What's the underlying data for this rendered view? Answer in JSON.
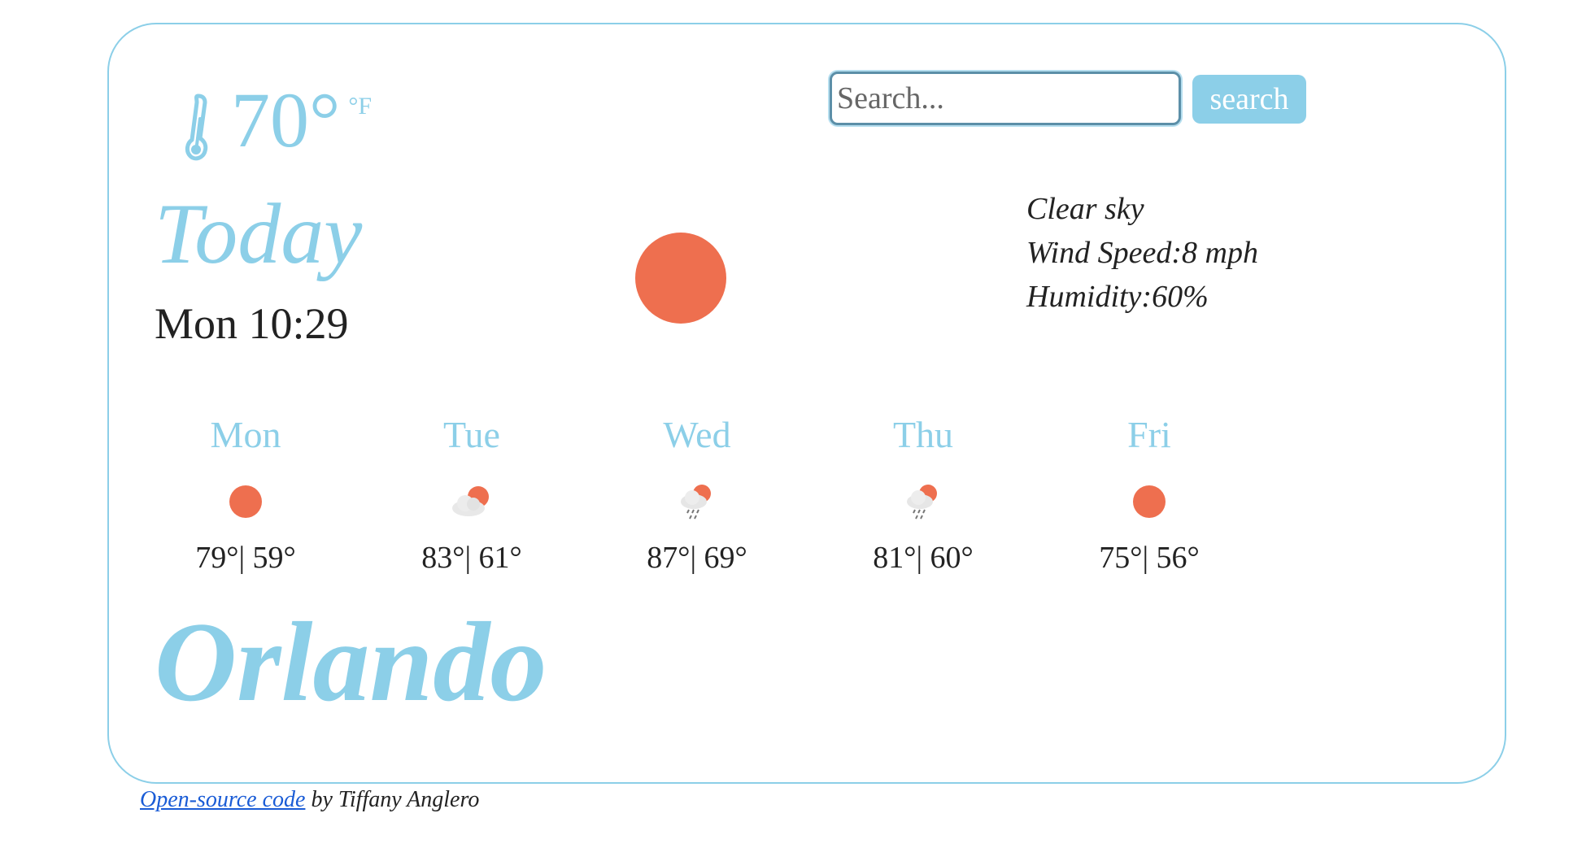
{
  "current": {
    "temperature": "70°",
    "unit": "°F",
    "day_label": "Today",
    "day_time": "Mon 10:29",
    "condition_icon": "sun-icon",
    "description": "Clear sky",
    "wind": "Wind Speed:8 mph",
    "humidity": "Humidity:60%"
  },
  "search": {
    "placeholder": "Search...",
    "value": "",
    "button_label": "search"
  },
  "forecast": [
    {
      "day": "Mon",
      "icon": "sun-icon",
      "temps": "79°| 59°"
    },
    {
      "day": "Tue",
      "icon": "partly-cloudy-icon",
      "temps": "83°| 61°"
    },
    {
      "day": "Wed",
      "icon": "rain-cloud-icon",
      "temps": "87°| 69°"
    },
    {
      "day": "Thu",
      "icon": "rain-cloud-icon",
      "temps": "81°| 60°"
    },
    {
      "day": "Fri",
      "icon": "sun-icon",
      "temps": "75°| 56°"
    }
  ],
  "city": "Orlando",
  "footer": {
    "link_text": "Open-source code",
    "suffix": " by Tiffany Anglero"
  },
  "colors": {
    "accent": "#8ccfe8",
    "sun": "#ee6f4f",
    "link": "#1a5cd6",
    "text": "#222222"
  }
}
